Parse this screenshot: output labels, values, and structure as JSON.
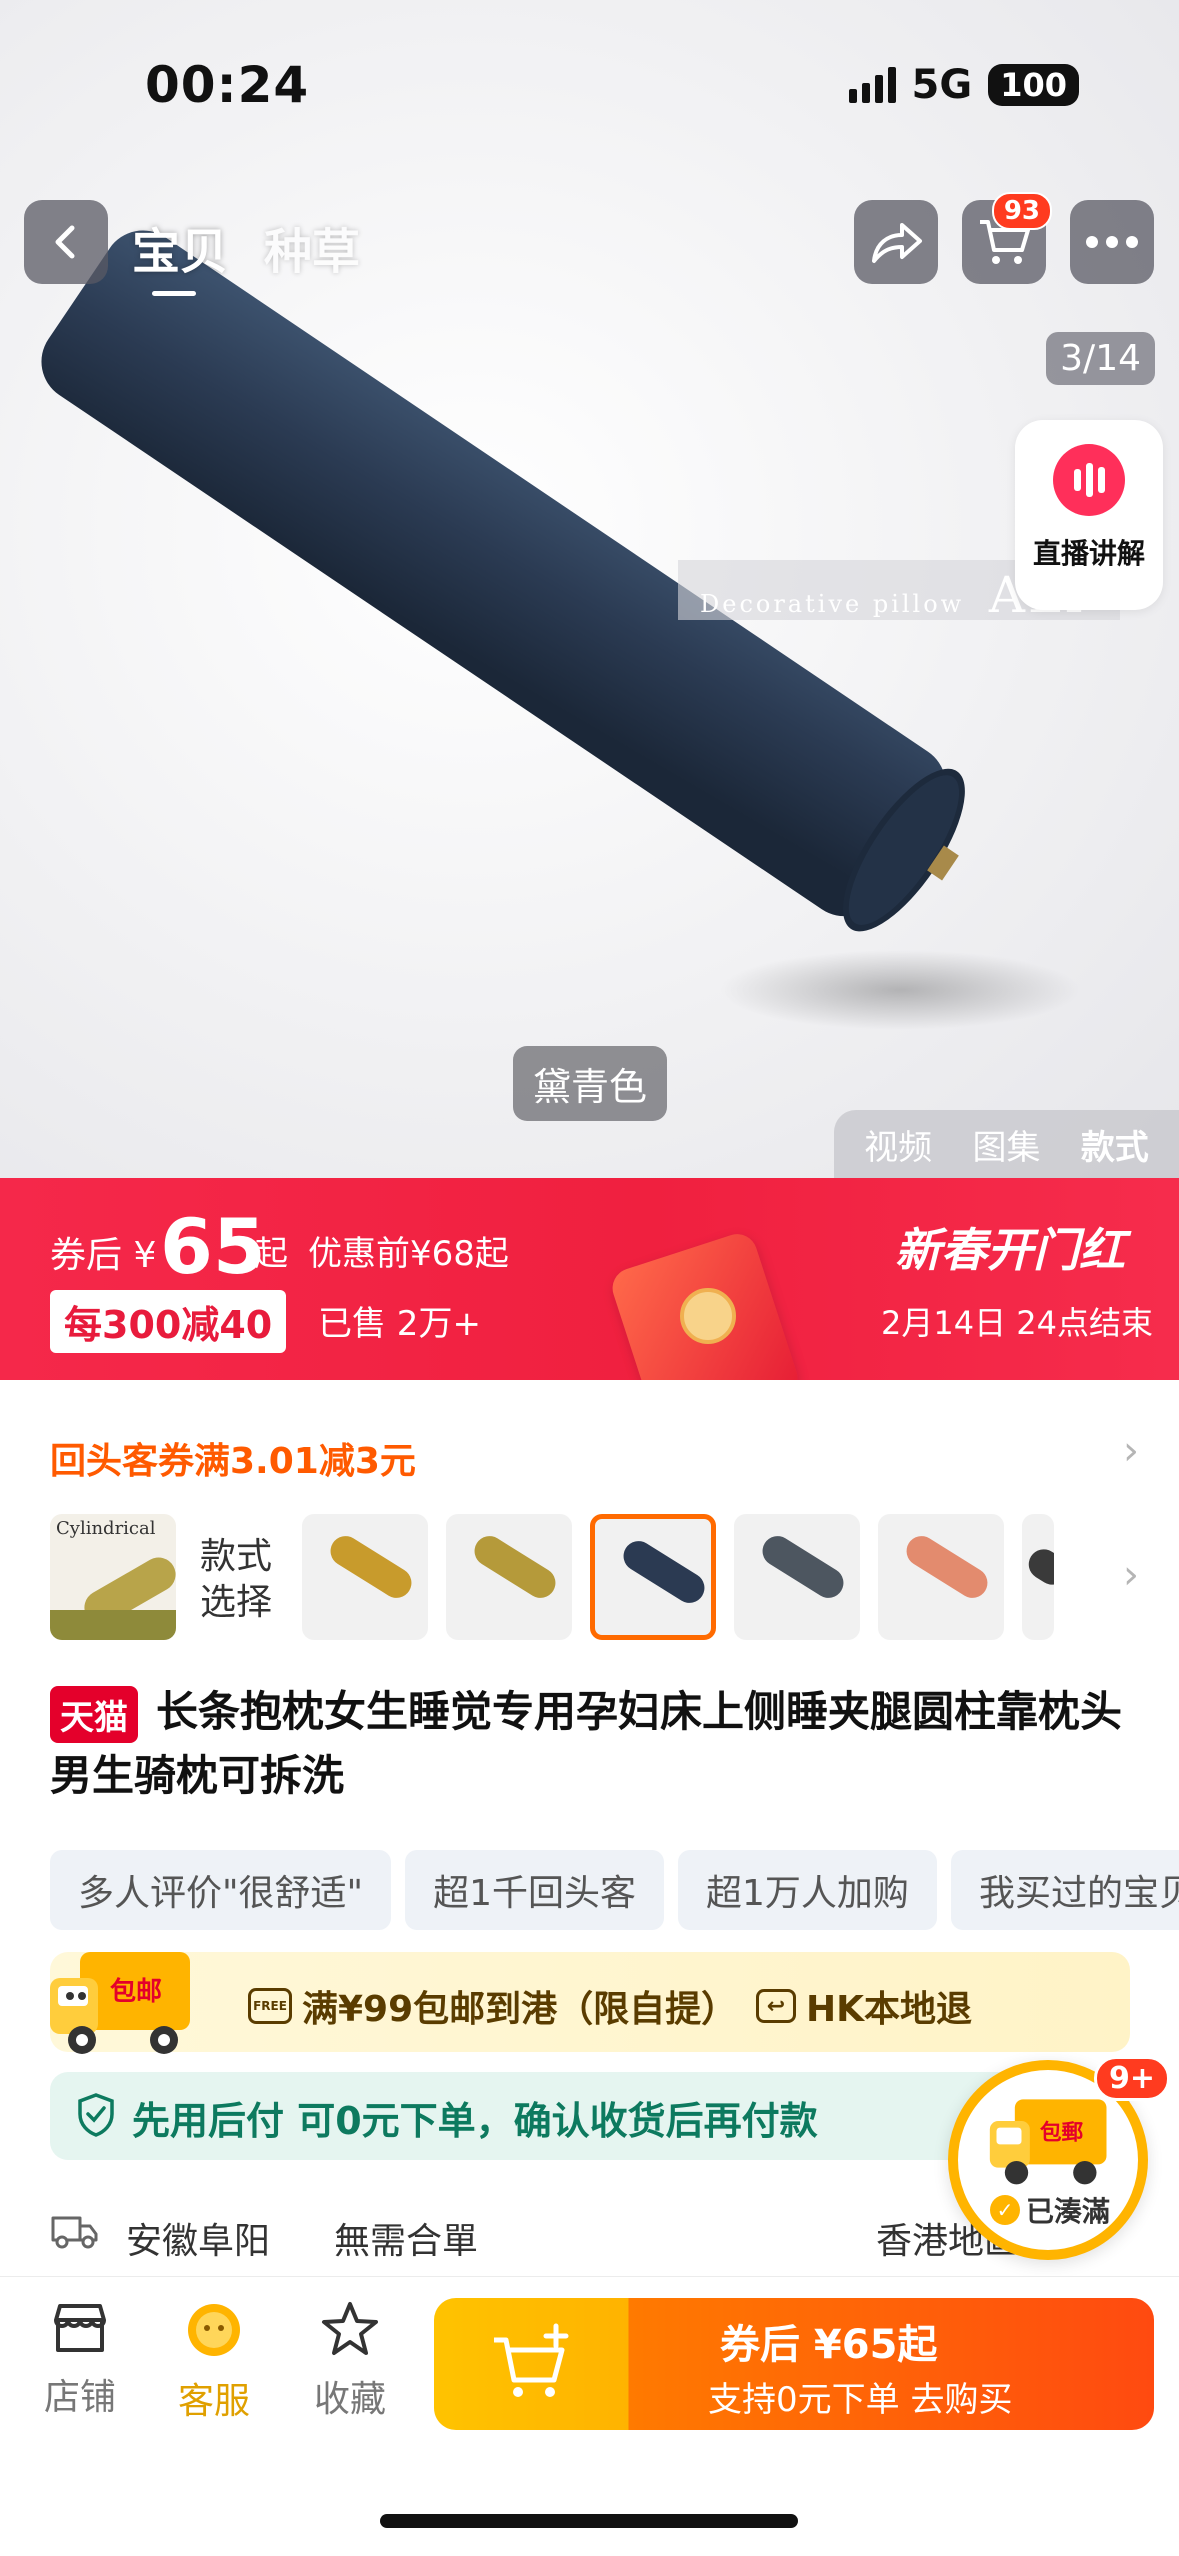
{
  "status": {
    "time": "00:24",
    "network": "5G",
    "battery": "100"
  },
  "nav": {
    "tab_active": "宝贝",
    "tab_other": "种草",
    "cart_count": "93"
  },
  "gallery": {
    "counter": "3/14",
    "live_label": "直播讲解",
    "watermark_text": "Decorative pillow",
    "watermark_brand": "ALI",
    "color_chip": "黛青色",
    "media_tabs": [
      "视频",
      "图集",
      "款式"
    ],
    "active_media_tab": "款式"
  },
  "promo": {
    "prefix": "券后",
    "currency": "¥",
    "price": "65",
    "qi": "起",
    "original": "优惠前¥68起",
    "tag": "每300减40",
    "sold": "已售 2万+",
    "event": "新春开门红",
    "end_time": "2月14日 24点结束"
  },
  "coupon": {
    "text": "回头客券满3.01减3元"
  },
  "swatches": {
    "label_line1": "款式",
    "label_line2": "选择",
    "cylindrical_text": "Cylindrical",
    "colors": [
      "#c89b2c",
      "#b59a3a",
      "#2b3a52",
      "#4d5660",
      "#e38b6e",
      "#3a3a3a"
    ],
    "selected_index": 2
  },
  "product": {
    "badge": "天猫",
    "title": "长条抱枕女生睡觉专用孕妇床上侧睡夹腿圆柱靠枕头男生骑枕可拆洗"
  },
  "chips": [
    "多人评价\"很舒适\"",
    "超1千回头客",
    "超1万人加购",
    "我买过的宝贝"
  ],
  "shipping": {
    "truck_label": "包邮",
    "free_icon": "FREE",
    "line": "满¥99包邮到港（限自提）",
    "hk_return": "HK本地退"
  },
  "pay_later": {
    "text": "先用后付 可0元下单，确认收货后再付款"
  },
  "location": {
    "origin": "安徽阜阳",
    "note": "無需合單",
    "dest": "香港地區"
  },
  "floating": {
    "badge": "9+",
    "truck_label": "包郵",
    "status": "已湊滿"
  },
  "bottom_bar": {
    "store": "店铺",
    "service": "客服",
    "favorite": "收藏",
    "buy_line1": "券后 ¥65起",
    "buy_line2": "支持0元下单 去购买"
  },
  "colors": {
    "accent_red": "#f0203f",
    "accent_orange": "#ff6a00",
    "tmall_red": "#e4002b",
    "pay_green": "#0d7a5f"
  }
}
